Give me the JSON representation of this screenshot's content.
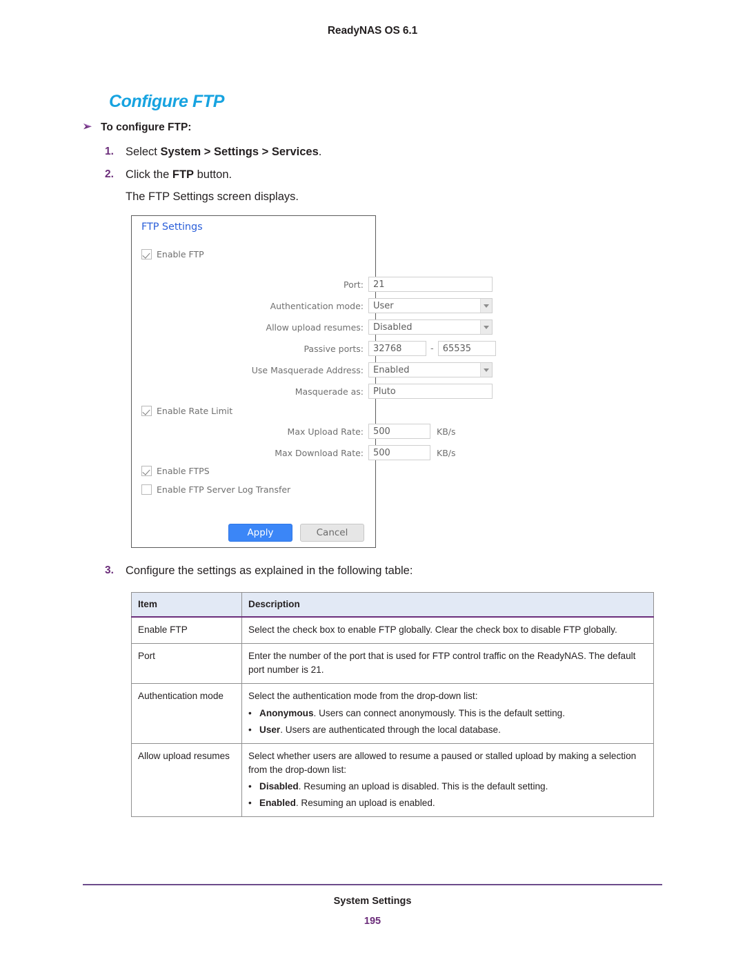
{
  "running_header": "ReadyNAS OS 6.1",
  "section_heading": "Configure FTP",
  "task_heading": "To configure FTP:",
  "steps": {
    "num1": "1.",
    "step1_pre": "Select ",
    "step1_bold": "System > Settings > Services",
    "step1_post": ".",
    "num2": "2.",
    "step2_pre": "Click the ",
    "step2_bold": "FTP",
    "step2_post": " button.",
    "step2_note": "The FTP Settings screen displays.",
    "num3": "3.",
    "step3": "Configure the settings as explained in the following table:"
  },
  "ftp_panel": {
    "title": "FTP Settings",
    "enable_ftp_label": "Enable FTP",
    "port_label": "Port:",
    "port_value": "21",
    "auth_label": "Authentication mode:",
    "auth_value": "User",
    "resume_label": "Allow upload resumes:",
    "resume_value": "Disabled",
    "passive_label": "Passive ports:",
    "passive_from": "32768",
    "passive_dash": "-",
    "passive_to": "65535",
    "masq_addr_label": "Use Masquerade Address:",
    "masq_addr_value": "Enabled",
    "masq_as_label": "Masquerade as:",
    "masq_as_value": "Pluto",
    "rate_limit_label": "Enable Rate Limit",
    "max_up_label": "Max Upload Rate:",
    "max_up_value": "500",
    "max_up_unit": "KB/s",
    "max_down_label": "Max Download Rate:",
    "max_down_value": "500",
    "max_down_unit": "KB/s",
    "ftps_label": "Enable FTPS",
    "logxfer_label": "Enable FTP Server Log Transfer",
    "apply_label": "Apply",
    "cancel_label": "Cancel"
  },
  "table": {
    "headers": [
      "Item",
      "Description"
    ],
    "rows": [
      {
        "item": "Enable FTP",
        "desc": "Select the check box to enable FTP globally. Clear the check box to disable FTP globally.",
        "bullets": []
      },
      {
        "item": "Port",
        "desc": "Enter the number of the port that is used for FTP control traffic on the ReadyNAS. The default port number is 21.",
        "bullets": []
      },
      {
        "item": "Authentication mode",
        "desc": "Select the authentication mode from the drop-down list:",
        "bullets": [
          {
            "bold": "Anonymous",
            "rest": ". Users can connect anonymously. This is the default setting."
          },
          {
            "bold": "User",
            "rest": ". Users are authenticated through the local database."
          }
        ]
      },
      {
        "item": "Allow upload resumes",
        "desc": "Select whether users are allowed to resume a paused or stalled upload by making a selection from the drop-down list:",
        "bullets": [
          {
            "bold": "Disabled",
            "rest": ". Resuming an upload is disabled. This is the default setting."
          },
          {
            "bold": "Enabled",
            "rest": ". Resuming an upload is enabled."
          }
        ]
      }
    ]
  },
  "footer": {
    "title": "System Settings",
    "page_number": "195"
  },
  "colors": {
    "heading_blue": "#17a3e0",
    "step_number_purple": "#6b2d7a",
    "panel_title_blue": "#2b5fd9",
    "apply_button_blue": "#3b86f7",
    "table_header_bg": "#e2e9f5"
  }
}
